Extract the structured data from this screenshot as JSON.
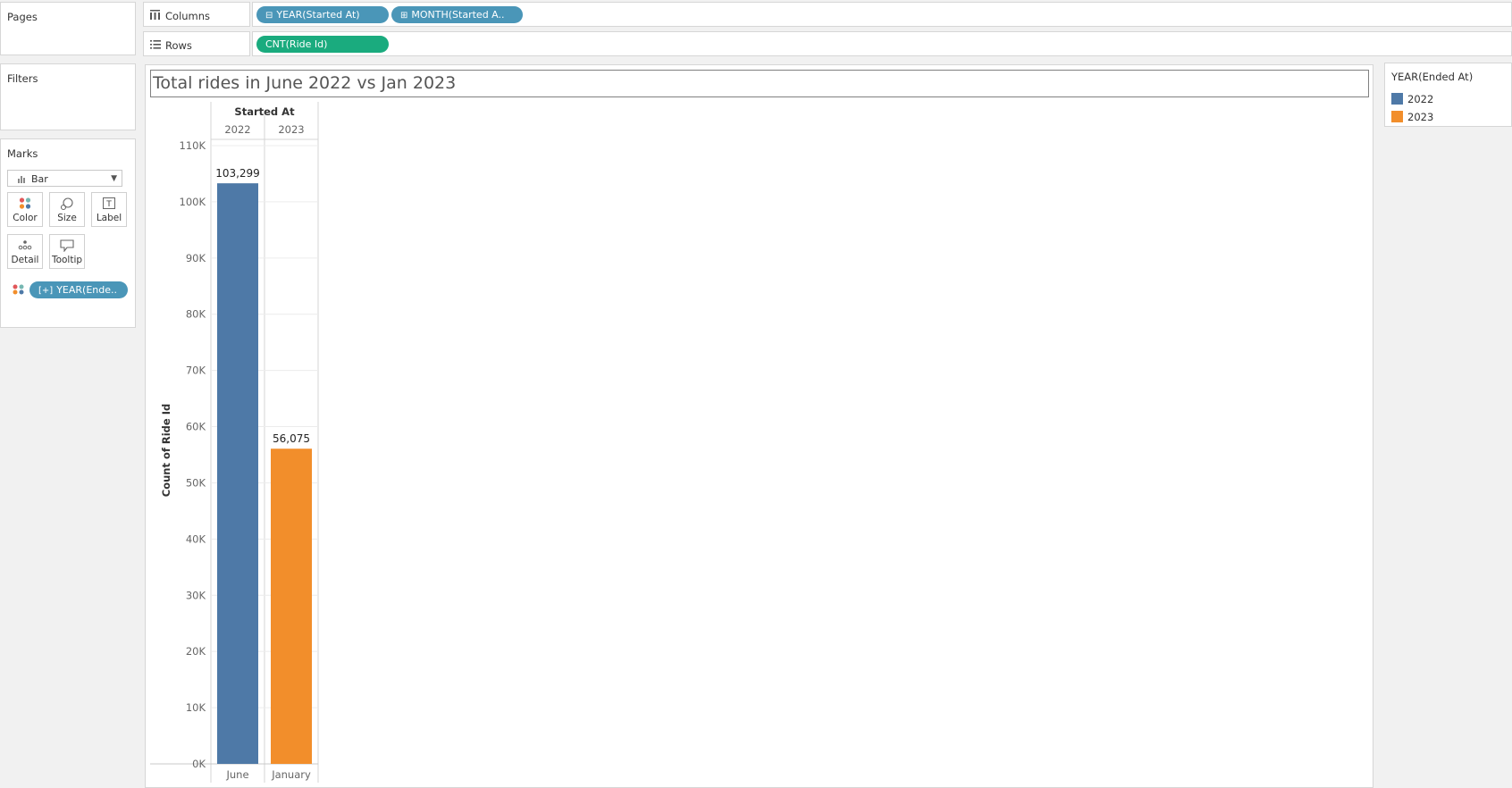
{
  "sidebar": {
    "pages_title": "Pages",
    "filters_title": "Filters",
    "marks_title": "Marks",
    "mark_type": "Bar",
    "mark_buttons": [
      "Color",
      "Size",
      "Label",
      "Detail",
      "Tooltip"
    ],
    "color_pill": "YEAR(Ende.."
  },
  "shelves": {
    "columns_label": "Columns",
    "rows_label": "Rows",
    "column_pills": [
      {
        "prefix": "⊟",
        "text": "YEAR(Started At)"
      },
      {
        "prefix": "⊞",
        "text": "MONTH(Started A.."
      }
    ],
    "row_pill": "CNT(Ride Id)"
  },
  "view": {
    "title": "Total rides in June 2022 vs Jan 2023"
  },
  "legend": {
    "title": "YEAR(Ended At)",
    "items": [
      {
        "label": "2022",
        "color": "#4e79a7"
      },
      {
        "label": "2023",
        "color": "#f28e2b"
      }
    ]
  },
  "chart_data": {
    "type": "bar",
    "column_header": "Started At",
    "years": [
      "2022",
      "2023"
    ],
    "categories": [
      "June",
      "January"
    ],
    "values": [
      103299,
      56075
    ],
    "value_labels": [
      "103,299",
      "56,075"
    ],
    "colors": [
      "#4e79a7",
      "#f28e2b"
    ],
    "ylabel": "Count of Ride Id",
    "ylim": [
      0,
      110000
    ],
    "y_ticks": [
      {
        "value": 0,
        "label": "0K"
      },
      {
        "value": 10000,
        "label": "10K"
      },
      {
        "value": 20000,
        "label": "20K"
      },
      {
        "value": 30000,
        "label": "30K"
      },
      {
        "value": 40000,
        "label": "40K"
      },
      {
        "value": 50000,
        "label": "50K"
      },
      {
        "value": 60000,
        "label": "60K"
      },
      {
        "value": 70000,
        "label": "70K"
      },
      {
        "value": 80000,
        "label": "80K"
      },
      {
        "value": 90000,
        "label": "90K"
      },
      {
        "value": 100000,
        "label": "100K"
      },
      {
        "value": 110000,
        "label": "110K"
      }
    ],
    "grid": true
  }
}
